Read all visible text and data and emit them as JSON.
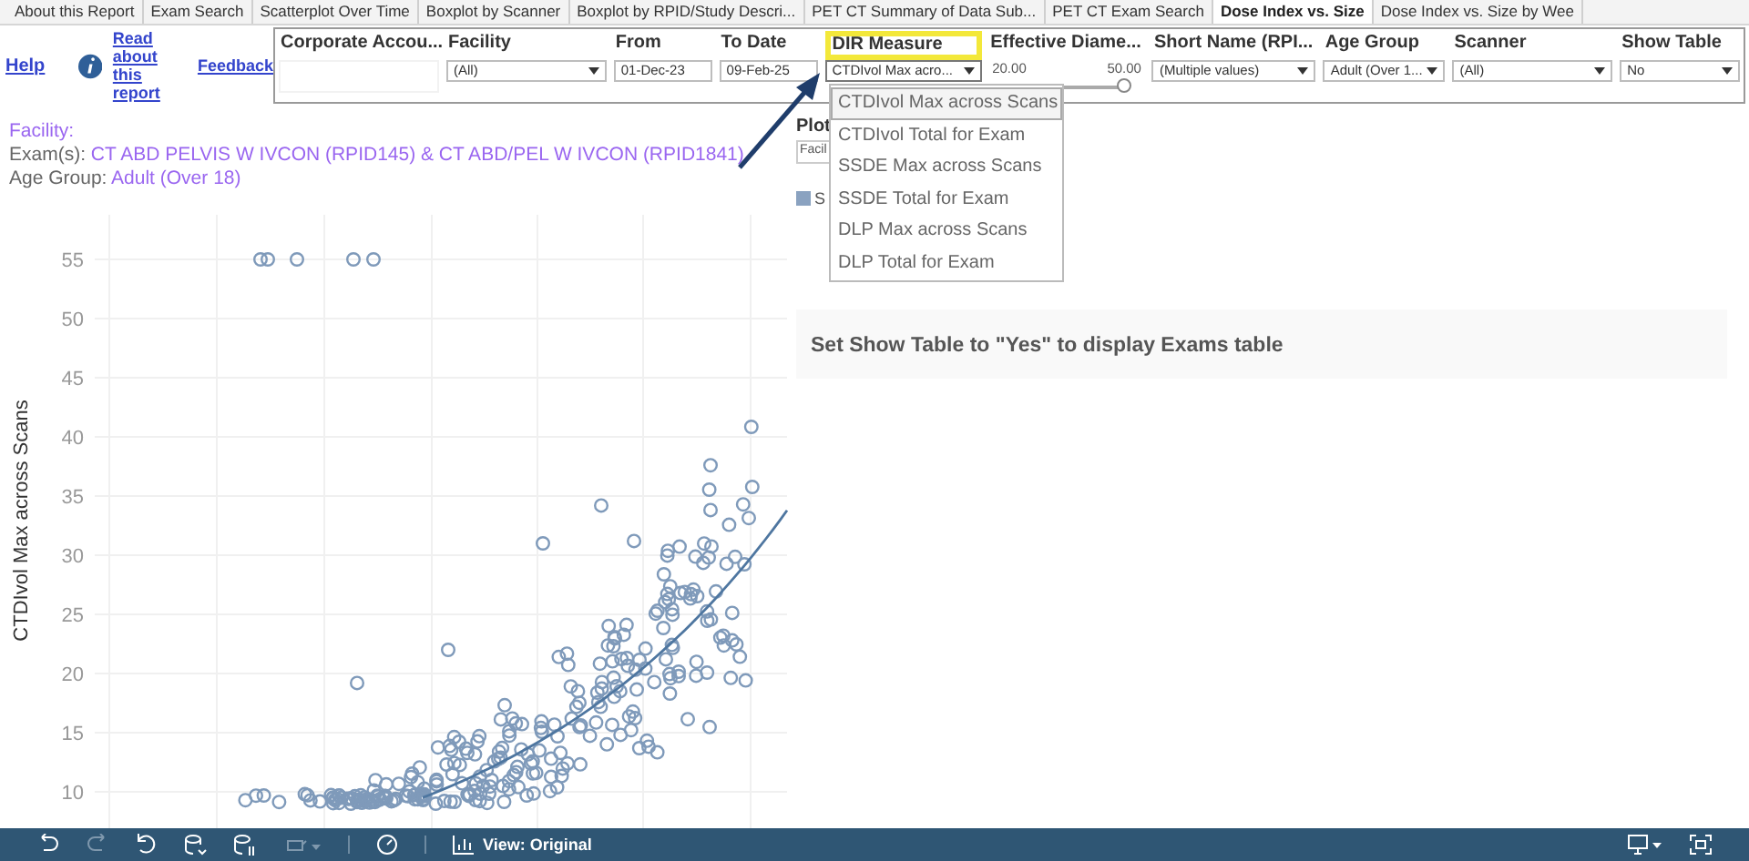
{
  "tabs": [
    {
      "label": "About this Report",
      "selected": false
    },
    {
      "label": "Exam Search",
      "selected": false
    },
    {
      "label": "Scatterplot Over Time",
      "selected": false
    },
    {
      "label": "Boxplot by Scanner",
      "selected": false
    },
    {
      "label": "Boxplot by RPID/Study Descri...",
      "selected": false
    },
    {
      "label": "PET CT Summary of Data Sub...",
      "selected": false
    },
    {
      "label": "PET CT Exam Search",
      "selected": false
    },
    {
      "label": "Dose Index vs. Size",
      "selected": true
    },
    {
      "label": "Dose Index vs. Size by Wee",
      "selected": false
    }
  ],
  "links": {
    "help": "Help",
    "about": "Read about this report",
    "feedback": "Feedback"
  },
  "filters": [
    {
      "kind": "blank",
      "label": "Corporate Accou..."
    },
    {
      "kind": "dropdown",
      "label": "Facility",
      "value": "(All)",
      "highlighted": false,
      "expanded": false
    },
    {
      "kind": "date",
      "label": "From",
      "value": "01-Dec-23"
    },
    {
      "kind": "date",
      "label": "To Date",
      "value": "09-Feb-25"
    },
    {
      "kind": "dropdown",
      "label": "DIR Measure",
      "value": "CTDIvol Max acro...",
      "highlighted": true,
      "expanded": true,
      "options": [
        {
          "label": "CTDIvol Max across Scans",
          "selected": true
        },
        {
          "label": "CTDIvol Total for Exam",
          "selected": false
        },
        {
          "label": "SSDE Max across Scans",
          "selected": false
        },
        {
          "label": "SSDE Total for Exam",
          "selected": false
        },
        {
          "label": "DLP Max across Scans",
          "selected": false
        },
        {
          "label": "DLP Total for Exam",
          "selected": false
        }
      ]
    },
    {
      "kind": "range",
      "label": "Effective Diame...",
      "min": "20.00",
      "max": "50.00",
      "level": 1
    },
    {
      "kind": "dropdown",
      "label": "Short Name (RPI...",
      "value": "(Multiple values)",
      "highlighted": false,
      "expanded": false
    },
    {
      "kind": "dropdown",
      "label": "Age Group",
      "value": "Adult (Over 1...",
      "highlighted": false,
      "expanded": false
    },
    {
      "kind": "dropdown",
      "label": "Scanner",
      "value": "(All)",
      "highlighted": false,
      "expanded": false
    },
    {
      "kind": "dropdown",
      "label": "Show Table",
      "value": "No",
      "highlighted": false,
      "expanded": false
    }
  ],
  "summary": {
    "facility": "Facility:",
    "exams_label": "Exam(s):",
    "exams": "CT ABD PELVIS W IVCON (RPID145) & CT ABD/PEL W IVCON (RPID1841)",
    "age_label": "Age Group:",
    "age": "Adult (Over 18)"
  },
  "chart": {
    "ylabel": "CTDIvol Max across Scans",
    "yticks": [
      "55",
      "50",
      "45",
      "40",
      "35",
      "30",
      "25",
      "20",
      "15",
      "10"
    ]
  },
  "side": {
    "plot_label": "Plot",
    "plot_field": "Facil",
    "legend_label": "S",
    "message": "Set Show Table to \"Yes\" to display Exams table"
  },
  "toolbar": {
    "view_label": "View: Original"
  }
}
